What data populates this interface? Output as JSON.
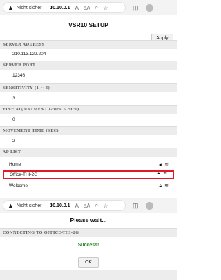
{
  "browser": {
    "warning_text": "Nicht sicher",
    "address": "10.10.0.1"
  },
  "setup": {
    "title": "VSR10 SETUP",
    "apply_label": "Apply",
    "sections": [
      {
        "label": "SERVER ADDRESS",
        "value": "210.113.122.204"
      },
      {
        "label": "SERVER PORT",
        "value": "12346"
      },
      {
        "label": "SENSITIVITY (1 ~ 5)",
        "value": "3"
      },
      {
        "label": "FINE ADJUSTMENT (-50% ~ 50%)",
        "value": "0"
      },
      {
        "label": "MOVEMENT TIME (SEC)",
        "value": "2"
      }
    ],
    "ap_list_label": "AP LIST",
    "ap_list": [
      {
        "name": "Home",
        "selected": false
      },
      {
        "name": "Office-THI-2G",
        "selected": true
      },
      {
        "name": "Welcome",
        "selected": false
      }
    ]
  },
  "wait": {
    "title": "Please wait...",
    "connecting_label": "CONNECTING TO OFFICE-THI-2G",
    "status": "Success!",
    "ok_label": "OK"
  },
  "colors": {
    "highlight": "#e01b24",
    "success": "#2a8a2a"
  }
}
